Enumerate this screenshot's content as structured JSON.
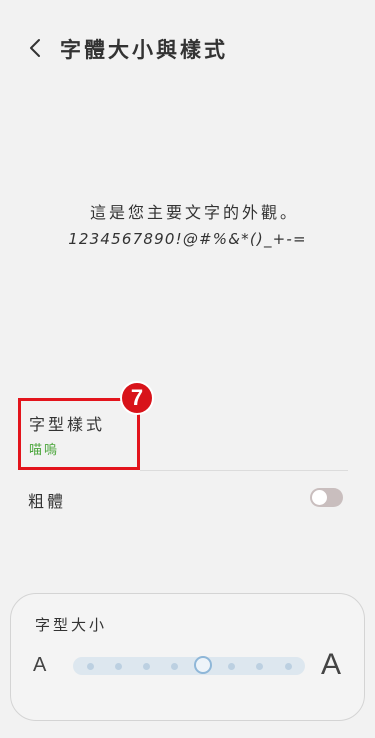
{
  "header": {
    "title": "字體大小與樣式",
    "back_icon": "chevron-left-icon"
  },
  "preview": {
    "line1": "這是您主要文字的外觀。",
    "line2": "1234567890!@#%&*()_+-="
  },
  "font_style": {
    "label": "字型樣式",
    "value": "喵嗚",
    "value_color": "#4aa53a",
    "highlight_color": "#e3141c",
    "step_badge": "7"
  },
  "bold": {
    "label": "粗體",
    "enabled": false
  },
  "font_size": {
    "label": "字型大小",
    "small_label": "A",
    "large_label": "A",
    "steps": 8,
    "current_step": 4
  }
}
